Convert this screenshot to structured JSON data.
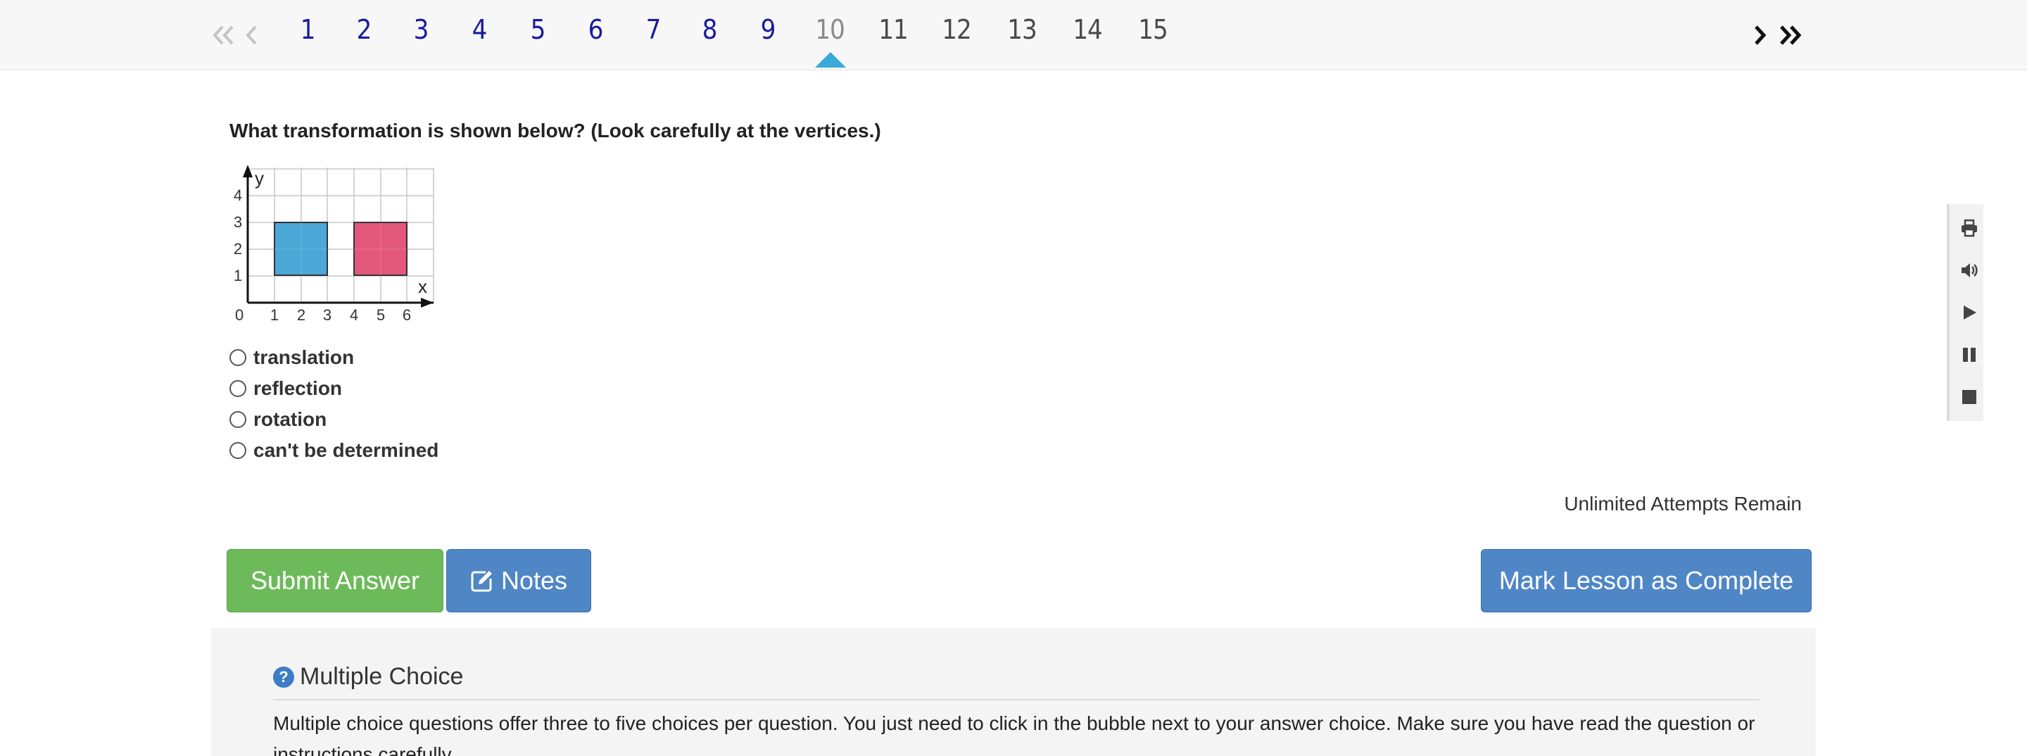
{
  "pagination": {
    "pages": [
      "1",
      "2",
      "3",
      "4",
      "5",
      "6",
      "7",
      "8",
      "9",
      "10",
      "11",
      "12",
      "13",
      "14",
      "15"
    ],
    "current": "10"
  },
  "question": {
    "text": "What transformation is shown below? (Look carefully at the vertices.)",
    "graph": {
      "x_axis_label": "x",
      "y_axis_label": "y",
      "origin_label": "0",
      "x_ticks": [
        "1",
        "2",
        "3",
        "4",
        "5",
        "6"
      ],
      "y_ticks": [
        "1",
        "2",
        "3",
        "4"
      ],
      "shape_colors": {
        "left": "#4aa7d6",
        "right": "#e2587a"
      }
    },
    "choices": [
      "translation",
      "reflection",
      "rotation",
      "can't be determined"
    ]
  },
  "status": {
    "attempts": "Unlimited Attempts Remain"
  },
  "buttons": {
    "submit": "Submit Answer",
    "notes": "Notes",
    "complete": "Mark Lesson as Complete"
  },
  "help": {
    "title": "Multiple Choice",
    "text": "Multiple choice questions offer three to five choices per question. You just need to click in the bubble next to your answer choice. Make sure you have read the question or instructions carefully."
  },
  "tools": [
    "print-icon",
    "speaker-icon",
    "play-icon",
    "pause-icon",
    "stop-icon"
  ],
  "colors": {
    "accent_blue": "#4f86c6",
    "submit_green": "#6dba5b",
    "visited_page": "#1a1a9e",
    "current_marker": "#3aa8db"
  }
}
